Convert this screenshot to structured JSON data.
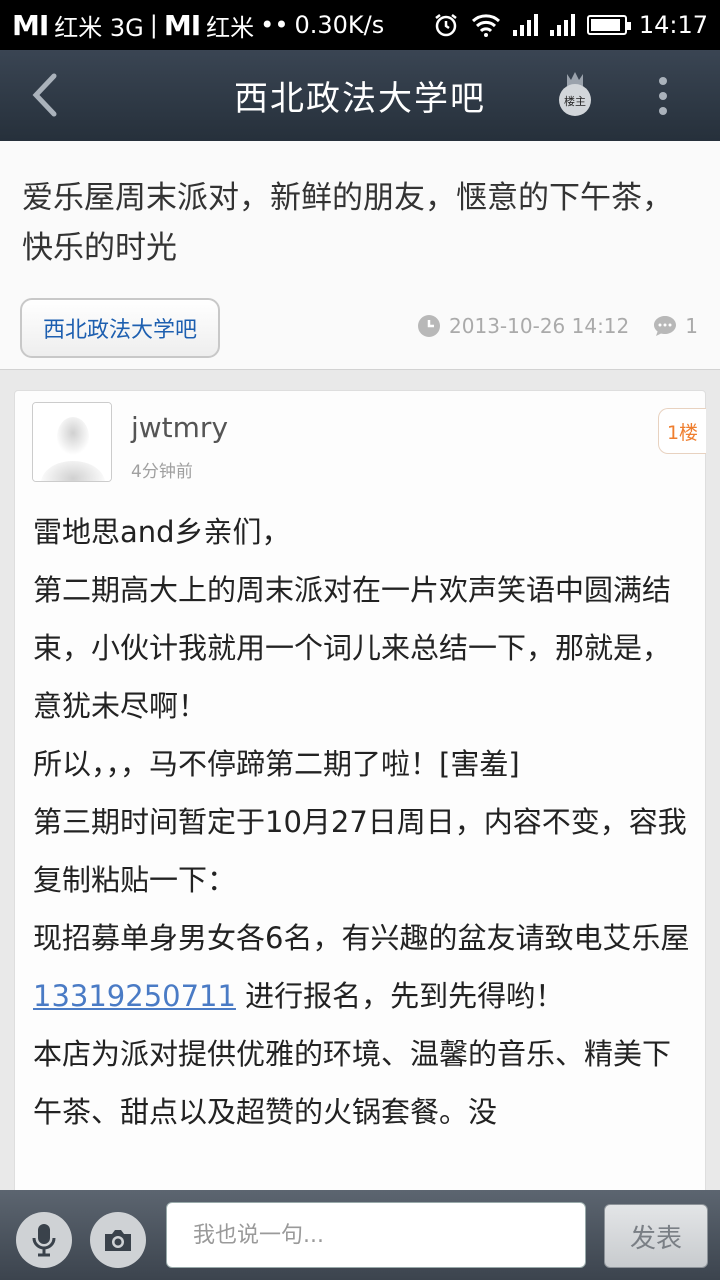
{
  "status_bar": {
    "carrier1_brand": "MI",
    "carrier1": "红米 3G",
    "carrier2_brand": "MI",
    "carrier2": "红米",
    "dots": "••",
    "speed": "0.30K/s",
    "time": "14:17",
    "battery_level": 0.9
  },
  "header": {
    "title": "西北政法大学吧",
    "host_badge": "楼主"
  },
  "post": {
    "title": "爱乐屋周末派对，新鲜的朋友，惬意的下午茶，快乐的时光",
    "forum_button": "西北政法大学吧",
    "timestamp": "2013-10-26 14:12",
    "reply_count": "1"
  },
  "floor": {
    "username": "jwtmry",
    "time_ago": "4分钟前",
    "floor_label": "1楼",
    "lines": [
      "雷地思and乡亲们，",
      "第二期高大上的周末派对在一片欢声笑语中圆满结束，小伙计我就用一个词儿来总结一下，那就是，意犹未尽啊！",
      "所以，，，马不停蹄第二期了啦！[害羞]",
      "第三期时间暂定于10月27日周日，内容不变，容我复制粘贴一下：",
      "本店为派对提供优雅的环境、温馨的音乐、精美下午茶、甜点以及超赞的火锅套餐。没"
    ],
    "recruit_before": "现招募单身男女各6名，有兴趣的盆友请致电艾乐屋",
    "phone": "13319250711",
    "recruit_after": " 进行报名，先到先得哟！"
  },
  "bottom_bar": {
    "input_placeholder": "我也说一句...",
    "send_label": "发表"
  }
}
